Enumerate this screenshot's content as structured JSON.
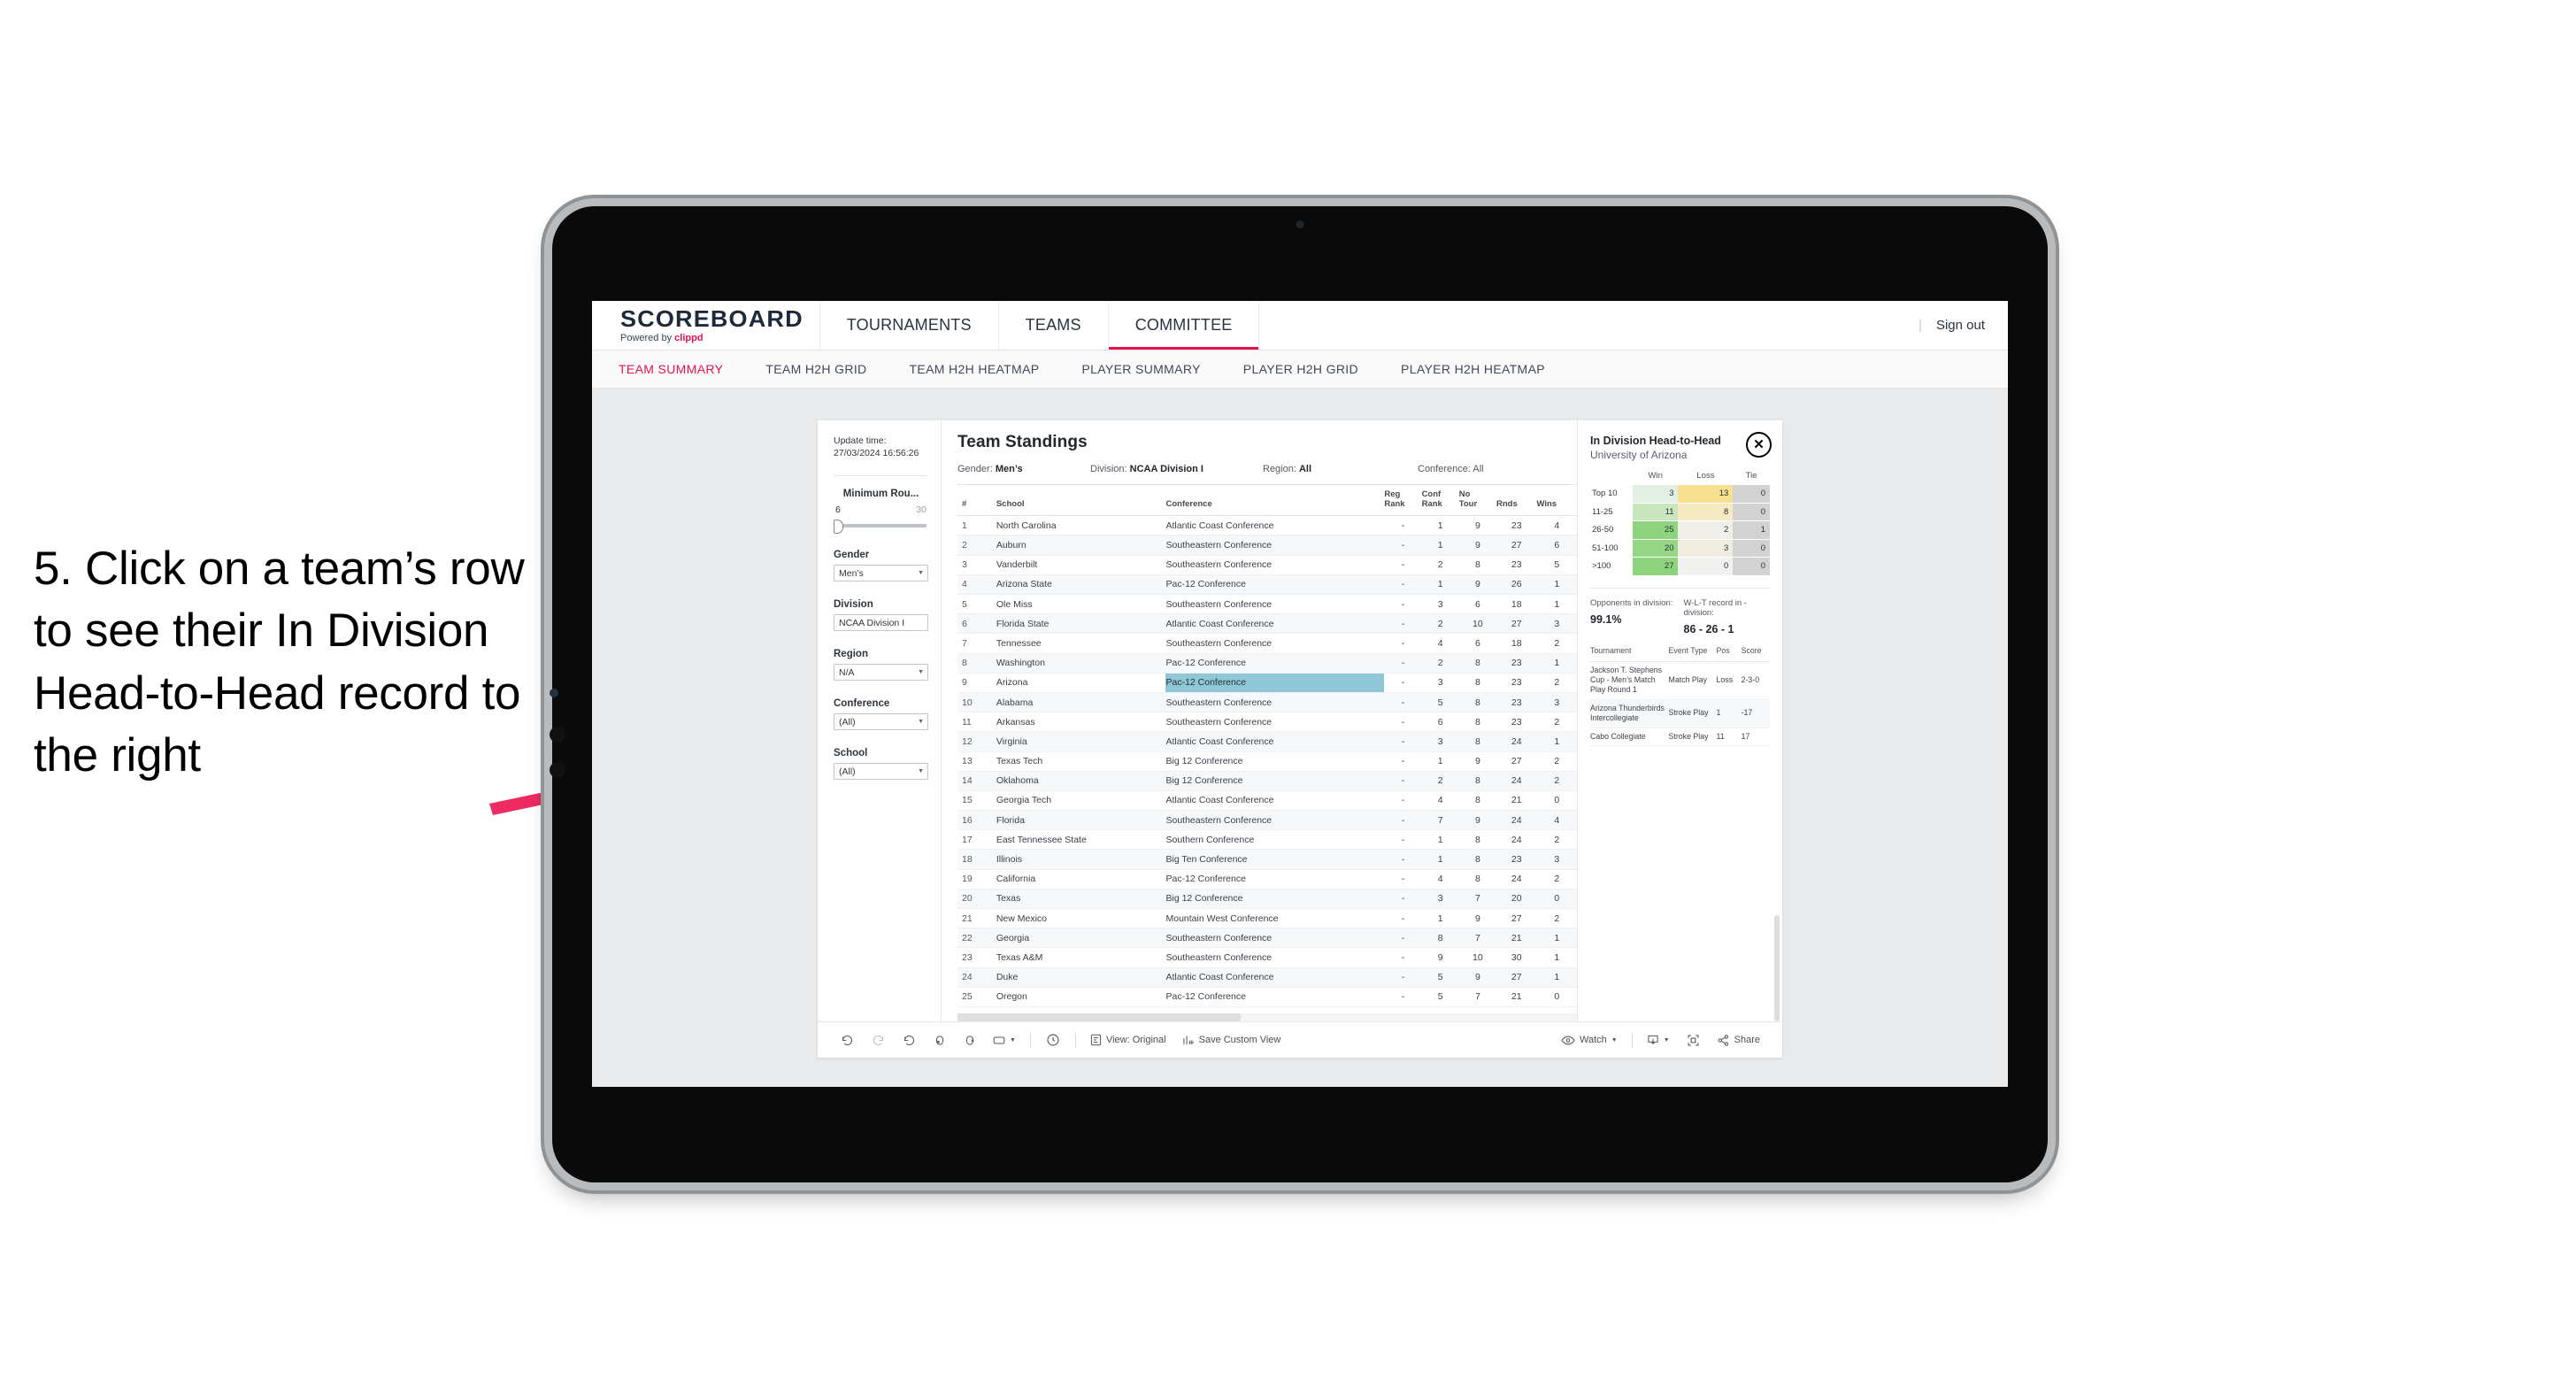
{
  "annotation": {
    "text": "5. Click on a team’s row to see their In Division Head-to-Head record to the right",
    "arrow_color": "#ef2a63"
  },
  "app": {
    "brand_title": "SCOREBOARD",
    "brand_sub_prefix": "Powered by ",
    "brand_sub_name": "clippd",
    "top_nav": [
      {
        "label": "TOURNAMENTS",
        "active": false
      },
      {
        "label": "TEAMS",
        "active": false
      },
      {
        "label": "COMMITTEE",
        "active": true
      }
    ],
    "sign_out": "Sign out",
    "sub_nav": [
      {
        "label": "TEAM SUMMARY",
        "active": true
      },
      {
        "label": "TEAM H2H GRID",
        "active": false
      },
      {
        "label": "TEAM H2H HEATMAP",
        "active": false
      },
      {
        "label": "PLAYER SUMMARY",
        "active": false
      },
      {
        "label": "PLAYER H2H GRID",
        "active": false
      },
      {
        "label": "PLAYER H2H HEATMAP",
        "active": false
      }
    ],
    "accent": "#e8134e"
  },
  "rail": {
    "update_label": "Update time:",
    "update_value": "27/03/2024 16:56:26",
    "slider": {
      "title": "Minimum Rou...",
      "min": "6",
      "max": "30"
    },
    "filters": [
      {
        "label": "Gender",
        "value": "Men’s"
      },
      {
        "label": "Division",
        "value": "NCAA Division I"
      },
      {
        "label": "Region",
        "value": "N/A"
      },
      {
        "label": "Conference",
        "value": "(All)"
      },
      {
        "label": "School",
        "value": "(All)"
      }
    ]
  },
  "standings": {
    "title": "Team Standings",
    "meta": [
      {
        "label": "Gender:",
        "value": "Men’s"
      },
      {
        "label": "Division:",
        "value": "NCAA Division I"
      },
      {
        "label": "Region:",
        "value": "All"
      },
      {
        "label": "Conference:",
        "value": "All"
      }
    ],
    "columns": [
      "#",
      "School",
      "Conference",
      "Reg Rank",
      "Conf Rank",
      "No Tour",
      "Rnds",
      "Wins"
    ],
    "rows": [
      {
        "rank": "1",
        "school": "North Carolina",
        "conf": "Atlantic Coast Conference",
        "reg": "-",
        "cr": "1",
        "nt": "9",
        "rnds": "23",
        "wins": "4",
        "hl": false
      },
      {
        "rank": "2",
        "school": "Auburn",
        "conf": "Southeastern Conference",
        "reg": "-",
        "cr": "1",
        "nt": "9",
        "rnds": "27",
        "wins": "6",
        "hl": false
      },
      {
        "rank": "3",
        "school": "Vanderbilt",
        "conf": "Southeastern Conference",
        "reg": "-",
        "cr": "2",
        "nt": "8",
        "rnds": "23",
        "wins": "5",
        "hl": false
      },
      {
        "rank": "4",
        "school": "Arizona State",
        "conf": "Pac-12 Conference",
        "reg": "-",
        "cr": "1",
        "nt": "9",
        "rnds": "26",
        "wins": "1",
        "hl": false
      },
      {
        "rank": "5",
        "school": "Ole Miss",
        "conf": "Southeastern Conference",
        "reg": "-",
        "cr": "3",
        "nt": "6",
        "rnds": "18",
        "wins": "1",
        "hl": false
      },
      {
        "rank": "6",
        "school": "Florida State",
        "conf": "Atlantic Coast Conference",
        "reg": "-",
        "cr": "2",
        "nt": "10",
        "rnds": "27",
        "wins": "3",
        "hl": false
      },
      {
        "rank": "7",
        "school": "Tennessee",
        "conf": "Southeastern Conference",
        "reg": "-",
        "cr": "4",
        "nt": "6",
        "rnds": "18",
        "wins": "2",
        "hl": false
      },
      {
        "rank": "8",
        "school": "Washington",
        "conf": "Pac-12 Conference",
        "reg": "-",
        "cr": "2",
        "nt": "8",
        "rnds": "23",
        "wins": "1",
        "hl": false
      },
      {
        "rank": "9",
        "school": "Arizona",
        "conf": "Pac-12 Conference",
        "reg": "-",
        "cr": "3",
        "nt": "8",
        "rnds": "23",
        "wins": "2",
        "hl": true
      },
      {
        "rank": "10",
        "school": "Alabama",
        "conf": "Southeastern Conference",
        "reg": "-",
        "cr": "5",
        "nt": "8",
        "rnds": "23",
        "wins": "3",
        "hl": false
      },
      {
        "rank": "11",
        "school": "Arkansas",
        "conf": "Southeastern Conference",
        "reg": "-",
        "cr": "6",
        "nt": "8",
        "rnds": "23",
        "wins": "2",
        "hl": false
      },
      {
        "rank": "12",
        "school": "Virginia",
        "conf": "Atlantic Coast Conference",
        "reg": "-",
        "cr": "3",
        "nt": "8",
        "rnds": "24",
        "wins": "1",
        "hl": false
      },
      {
        "rank": "13",
        "school": "Texas Tech",
        "conf": "Big 12 Conference",
        "reg": "-",
        "cr": "1",
        "nt": "9",
        "rnds": "27",
        "wins": "2",
        "hl": false
      },
      {
        "rank": "14",
        "school": "Oklahoma",
        "conf": "Big 12 Conference",
        "reg": "-",
        "cr": "2",
        "nt": "8",
        "rnds": "24",
        "wins": "2",
        "hl": false
      },
      {
        "rank": "15",
        "school": "Georgia Tech",
        "conf": "Atlantic Coast Conference",
        "reg": "-",
        "cr": "4",
        "nt": "8",
        "rnds": "21",
        "wins": "0",
        "hl": false
      },
      {
        "rank": "16",
        "school": "Florida",
        "conf": "Southeastern Conference",
        "reg": "-",
        "cr": "7",
        "nt": "9",
        "rnds": "24",
        "wins": "4",
        "hl": false
      },
      {
        "rank": "17",
        "school": "East Tennessee State",
        "conf": "Southern Conference",
        "reg": "-",
        "cr": "1",
        "nt": "8",
        "rnds": "24",
        "wins": "2",
        "hl": false
      },
      {
        "rank": "18",
        "school": "Illinois",
        "conf": "Big Ten Conference",
        "reg": "-",
        "cr": "1",
        "nt": "8",
        "rnds": "23",
        "wins": "3",
        "hl": false
      },
      {
        "rank": "19",
        "school": "California",
        "conf": "Pac-12 Conference",
        "reg": "-",
        "cr": "4",
        "nt": "8",
        "rnds": "24",
        "wins": "2",
        "hl": false
      },
      {
        "rank": "20",
        "school": "Texas",
        "conf": "Big 12 Conference",
        "reg": "-",
        "cr": "3",
        "nt": "7",
        "rnds": "20",
        "wins": "0",
        "hl": false
      },
      {
        "rank": "21",
        "school": "New Mexico",
        "conf": "Mountain West Conference",
        "reg": "-",
        "cr": "1",
        "nt": "9",
        "rnds": "27",
        "wins": "2",
        "hl": false
      },
      {
        "rank": "22",
        "school": "Georgia",
        "conf": "Southeastern Conference",
        "reg": "-",
        "cr": "8",
        "nt": "7",
        "rnds": "21",
        "wins": "1",
        "hl": false
      },
      {
        "rank": "23",
        "school": "Texas A&M",
        "conf": "Southeastern Conference",
        "reg": "-",
        "cr": "9",
        "nt": "10",
        "rnds": "30",
        "wins": "1",
        "hl": false
      },
      {
        "rank": "24",
        "school": "Duke",
        "conf": "Atlantic Coast Conference",
        "reg": "-",
        "cr": "5",
        "nt": "9",
        "rnds": "27",
        "wins": "1",
        "hl": false
      },
      {
        "rank": "25",
        "school": "Oregon",
        "conf": "Pac-12 Conference",
        "reg": "-",
        "cr": "5",
        "nt": "7",
        "rnds": "21",
        "wins": "0",
        "hl": false
      }
    ]
  },
  "detail": {
    "title": "In Division Head-to-Head",
    "subtitle": "University of Arizona",
    "close_icon": "close-icon",
    "h2h_columns": [
      "",
      "Win",
      "Loss",
      "Tie"
    ],
    "h2h_rows": [
      {
        "band": "Top 10",
        "win": "3",
        "loss": "13",
        "tie": "0",
        "win_bg": "#e3eee4",
        "loss_bg": "#f4e08f",
        "tie_bg": "#d2d2d2"
      },
      {
        "band": "11-25",
        "win": "11",
        "loss": "8",
        "tie": "0",
        "win_bg": "#c9e6bf",
        "loss_bg": "#f6eac3",
        "tie_bg": "#d2d2d2"
      },
      {
        "band": "26-50",
        "win": "25",
        "loss": "2",
        "tie": "1",
        "win_bg": "#8ed47e",
        "loss_bg": "#f0efe9",
        "tie_bg": "#d2d2d2"
      },
      {
        "band": "51-100",
        "win": "20",
        "loss": "3",
        "tie": "0",
        "win_bg": "#95d785",
        "loss_bg": "#f0ece0",
        "tie_bg": "#d2d2d2"
      },
      {
        "band": ">100",
        "win": "27",
        "loss": "0",
        "tie": "0",
        "win_bg": "#8ed47e",
        "loss_bg": "#f1f1ef",
        "tie_bg": "#d2d2d2"
      }
    ],
    "stats": [
      {
        "label": "Opponents in division:",
        "value": "99.1%"
      },
      {
        "label": "W-L-T record in -division:",
        "value": "86 - 26 - 1"
      }
    ],
    "tournament_columns": [
      "Tournament",
      "Event Type",
      "Pos",
      "Score"
    ],
    "tournaments": [
      {
        "name": "Jackson T. Stephens Cup - Men’s Match Play Round 1",
        "type": "Match Play",
        "pos": "Loss",
        "score": "2-3-0"
      },
      {
        "name": "Arizona Thunderbirds Intercollegiate",
        "type": "Stroke Play",
        "pos": "1",
        "score": "-17"
      },
      {
        "name": "Cabo Collegiate",
        "type": "Stroke Play",
        "pos": "11",
        "score": "17"
      }
    ]
  },
  "toolbar": {
    "undo": "undo-icon",
    "redo": "redo-icon",
    "revert": "revert-icon",
    "refresh": "refresh-icon",
    "pause": "pause-icon",
    "device": "device-layout-icon",
    "dropdown_caret": "chevron-down-icon",
    "timer": "timer-icon",
    "view_label": "View: Original",
    "save_label": "Save Custom View",
    "watch_label": "Watch",
    "download": "download-icon",
    "fullscreen": "fullscreen-icon",
    "share_label": "Share"
  }
}
